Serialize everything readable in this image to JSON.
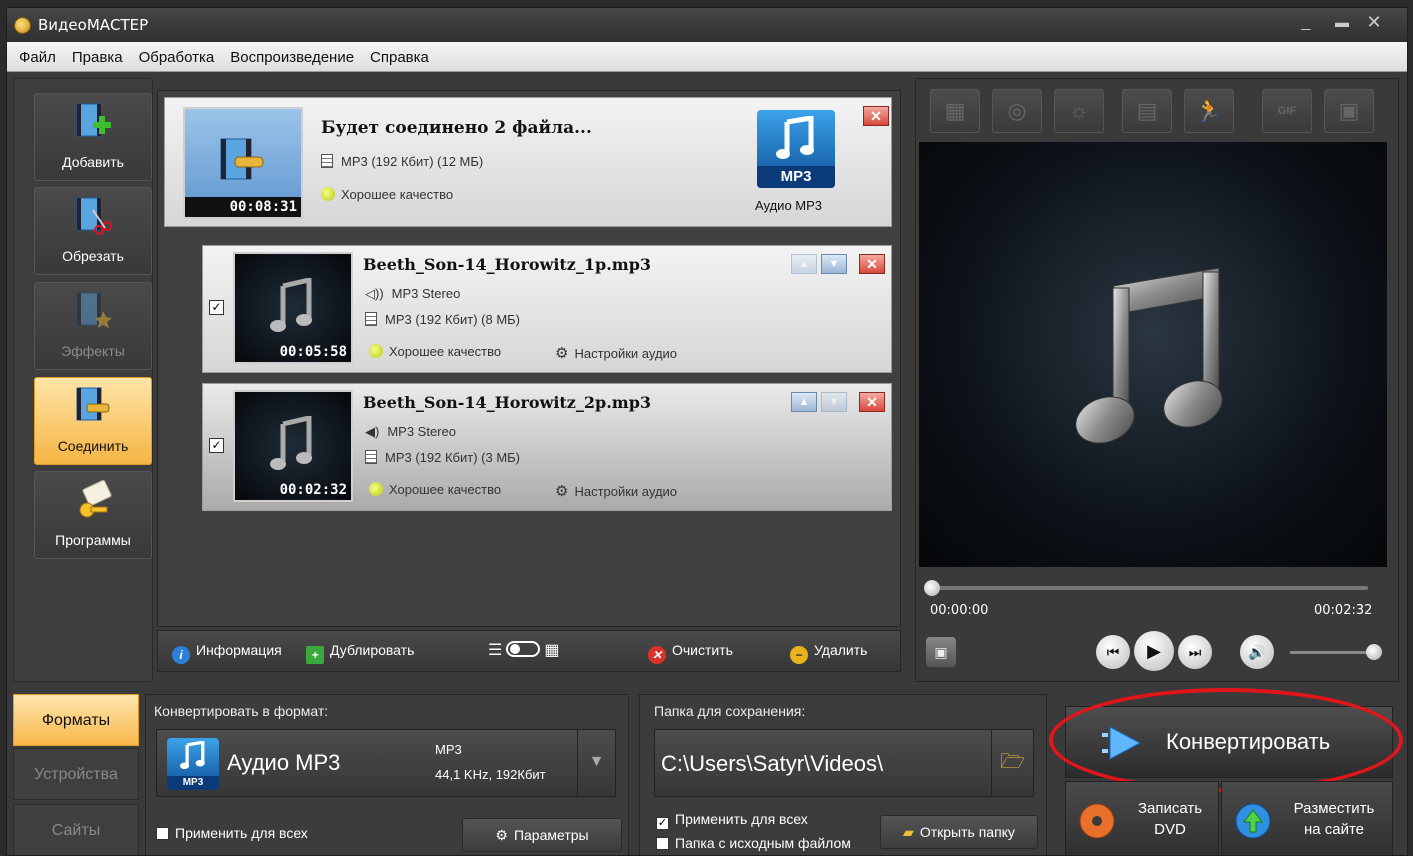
{
  "window": {
    "title": "ВидеоМАСТЕР"
  },
  "menu": [
    "Файл",
    "Правка",
    "Обработка",
    "Воспроизведение",
    "Справка"
  ],
  "sidebar": [
    {
      "label": "Добавить",
      "state": "normal",
      "icon": "film-add-icon"
    },
    {
      "label": "Обрезать",
      "state": "normal",
      "icon": "film-scissors-icon"
    },
    {
      "label": "Эффекты",
      "state": "disabled",
      "icon": "film-effects-icon"
    },
    {
      "label": "Соединить",
      "state": "active",
      "icon": "film-join-icon"
    },
    {
      "label": "Программы",
      "state": "normal",
      "icon": "card-key-icon"
    }
  ],
  "merge": {
    "title": "Будет соединено 2 файла...",
    "format": "MP3 (192 Кбит) (12 МБ)",
    "quality": "Хорошее качество",
    "duration": "00:08:31",
    "preset_tag": "MP3",
    "preset_label": "Аудио MP3"
  },
  "files": [
    {
      "name": "Beeth_Son-14_Horowitz_1p.mp3",
      "audio": "MP3 Stereo",
      "format": "MP3 (192 Кбит) (8 МБ)",
      "quality": "Хорошее качество",
      "settings": "Настройки аудио",
      "duration": "00:05:58",
      "checked": "✓"
    },
    {
      "name": "Beeth_Son-14_Horowitz_2p.mp3",
      "audio": "MP3 Stereo",
      "format": "MP3 (192 Кбит) (3 МБ)",
      "quality": "Хорошее качество",
      "settings": "Настройки аудио",
      "duration": "00:02:32",
      "checked": "✓"
    }
  ],
  "list_toolbar": {
    "info": "Информация",
    "duplicate": "Дублировать",
    "clear": "Очистить",
    "delete": "Удалить"
  },
  "player": {
    "time_current": "00:00:00",
    "time_total": "00:02:32",
    "progress": 0,
    "volume": 1.0
  },
  "preview_tools": [
    "film-frame-icon",
    "record-icon",
    "brightness-icon",
    "crop-icon",
    "speed-icon",
    "gif-icon",
    "export-frame-icon"
  ],
  "gif_label": "GIF",
  "bottom_tabs": [
    "Форматы",
    "Устройства",
    "Сайты"
  ],
  "convert_format": {
    "label": "Конвертировать в формат:",
    "name": "Аудио MP3",
    "codec": "MP3",
    "details": "44,1 KHz, 192Кбит",
    "tag": "MP3",
    "apply_all": "Применить для всех",
    "params": "Параметры"
  },
  "save_folder": {
    "label": "Папка для сохранения:",
    "path": "C:\\Users\\Satyr\\Videos\\",
    "apply_all": "Применить для всех",
    "source_folder": "Папка с исходным файлом",
    "open_folder": "Открыть папку",
    "apply_checked": "✓"
  },
  "actions": {
    "convert": "Конвертировать",
    "burn": "Записать\nDVD",
    "publish": "Разместить\nна сайте"
  },
  "colors": {
    "accent": "#f5b543",
    "highlight": "#e0161b",
    "mp3_blue": "#1f7fd1"
  }
}
